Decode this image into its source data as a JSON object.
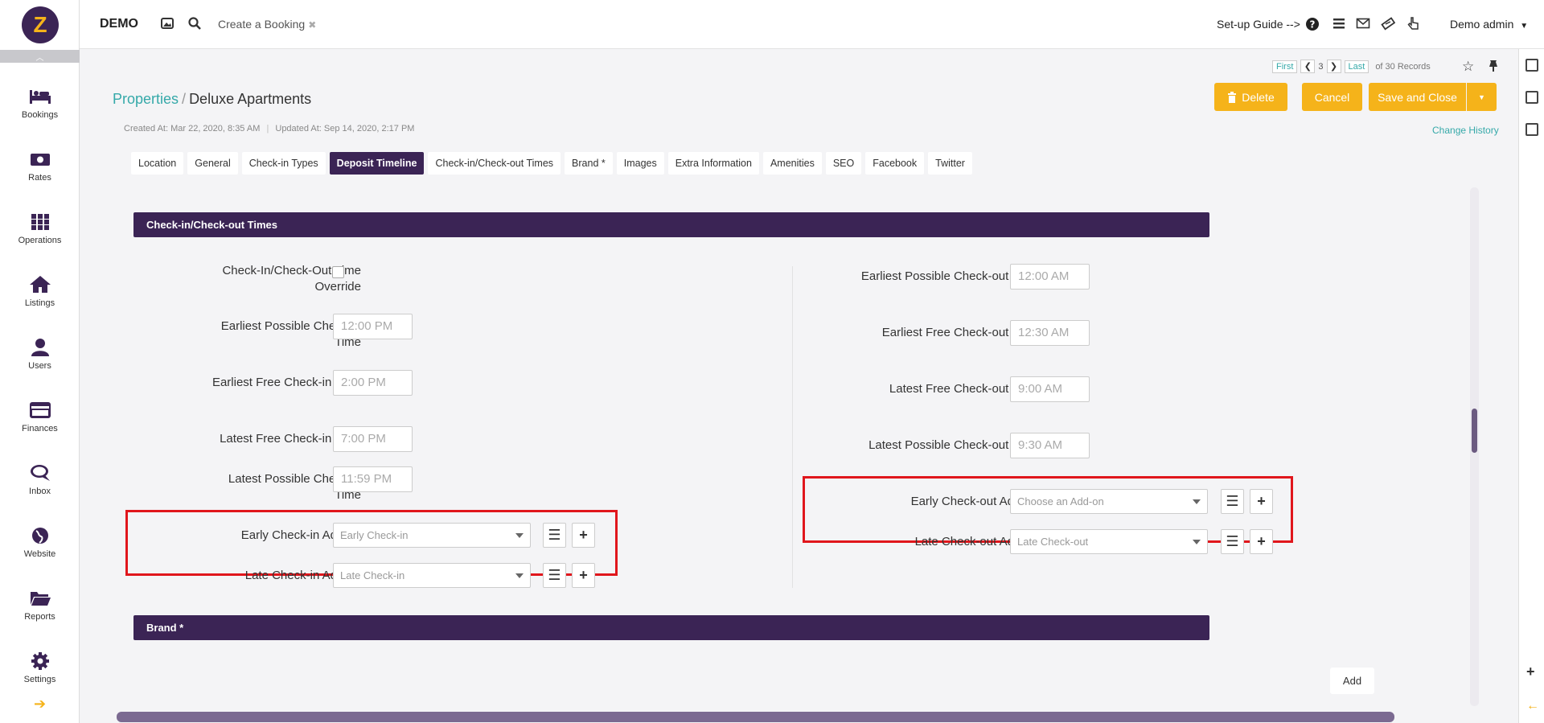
{
  "app": {
    "name": "DEMO",
    "logo_letter": "Z"
  },
  "topbar": {
    "booking_tab": "Create a Booking",
    "booking_tab_close": "✖",
    "setup_guide": "Set-up Guide -->",
    "user": "Demo admin"
  },
  "sidebar": {
    "items": [
      {
        "label": "Bookings",
        "icon": "bed-icon"
      },
      {
        "label": "Rates",
        "icon": "money-icon"
      },
      {
        "label": "Operations",
        "icon": "grid-icon"
      },
      {
        "label": "Listings",
        "icon": "home-icon"
      },
      {
        "label": "Users",
        "icon": "user-icon"
      },
      {
        "label": "Finances",
        "icon": "credit-card-icon"
      },
      {
        "label": "Inbox",
        "icon": "chat-icon"
      },
      {
        "label": "Website",
        "icon": "globe-icon"
      },
      {
        "label": "Reports",
        "icon": "folder-icon"
      },
      {
        "label": "Settings",
        "icon": "gear-icon"
      }
    ]
  },
  "pager": {
    "first": "First",
    "current": "3",
    "last": "Last",
    "total": "of 30 Records"
  },
  "breadcrumb": {
    "parent": "Properties",
    "separator": "/",
    "current": "Deluxe Apartments"
  },
  "meta": {
    "created": "Created At: Mar 22, 2020, 8:35 AM",
    "updated": "Updated At: Sep 14, 2020, 2:17 PM"
  },
  "actions": {
    "delete": "Delete",
    "cancel": "Cancel",
    "save_close": "Save and Close",
    "change_history": "Change History"
  },
  "tabs": [
    "Location",
    "General",
    "Check-in Types",
    "Deposit Timeline",
    "Check-in/Check-out Times",
    "Brand *",
    "Images",
    "Extra Information",
    "Amenities",
    "SEO",
    "Facebook",
    "Twitter"
  ],
  "active_tab": "Deposit Timeline",
  "section": {
    "title": "Check-in/Check-out Times",
    "left": {
      "override_label": "Check-In/Check-Out Time Override",
      "earliest_possible_checkin": {
        "label": "Earliest Possible Check-in Time",
        "value": "12:00 PM"
      },
      "earliest_free_checkin": {
        "label": "Earliest Free Check-in Time",
        "value": "2:00 PM"
      },
      "latest_free_checkin": {
        "label": "Latest Free Check-in Time",
        "value": "7:00 PM"
      },
      "latest_possible_checkin": {
        "label": "Latest Possible Check-in Time",
        "value": "11:59 PM"
      },
      "early_addon": {
        "label": "Early Check-in Add-on",
        "value": "Early Check-in"
      },
      "late_addon": {
        "label": "Late Check-in Add-on",
        "value": "Late Check-in"
      }
    },
    "right": {
      "earliest_possible_checkout": {
        "label": "Earliest Possible Check-out Time",
        "value": "12:00 AM"
      },
      "earliest_free_checkout": {
        "label": "Earliest Free Check-out Time",
        "value": "12:30 AM"
      },
      "latest_free_checkout": {
        "label": "Latest Free Check-out Time",
        "value": "9:00 AM"
      },
      "latest_possible_checkout": {
        "label": "Latest Possible Check-out Time",
        "value": "9:30 AM"
      },
      "early_addon": {
        "label": "Early Check-out Add-on",
        "placeholder": "Choose an Add-on"
      },
      "late_addon": {
        "label": "Late Check-out Add-on",
        "value": "Late Check-out"
      }
    }
  },
  "brand_section": {
    "title": "Brand *",
    "add": "Add"
  }
}
